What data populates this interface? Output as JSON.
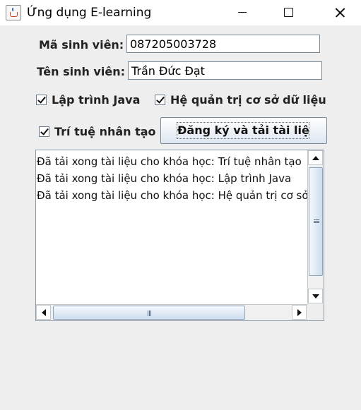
{
  "window": {
    "title": "Ứng dụng E-learning",
    "icons": [
      "java-app-icon",
      "minimize-icon",
      "maximize-icon",
      "close-icon"
    ]
  },
  "form": {
    "student_id_label": "Mã sinh viên:",
    "student_id_value": "087205003728",
    "student_name_label": "Tên sinh viên:",
    "student_name_value": "Trần Đức Đạt"
  },
  "courses": [
    {
      "label": "Lập trình Java",
      "checked": true
    },
    {
      "label": "Hệ quản trị cơ sở dữ liệu",
      "checked": true
    },
    {
      "label": "Trí tuệ nhân tạo",
      "checked": true
    }
  ],
  "actions": {
    "register_label": "Đăng ký và tải tài liệu"
  },
  "log": {
    "lines": [
      "Đã tải xong tài liệu cho khóa học: Trí tuệ nhân tạo",
      "Đã tải xong tài liệu cho khóa học: Lập trình Java",
      "Đã tải xong tài liệu cho khóa học: Hệ quản trị cơ sở dữ liệu"
    ]
  }
}
